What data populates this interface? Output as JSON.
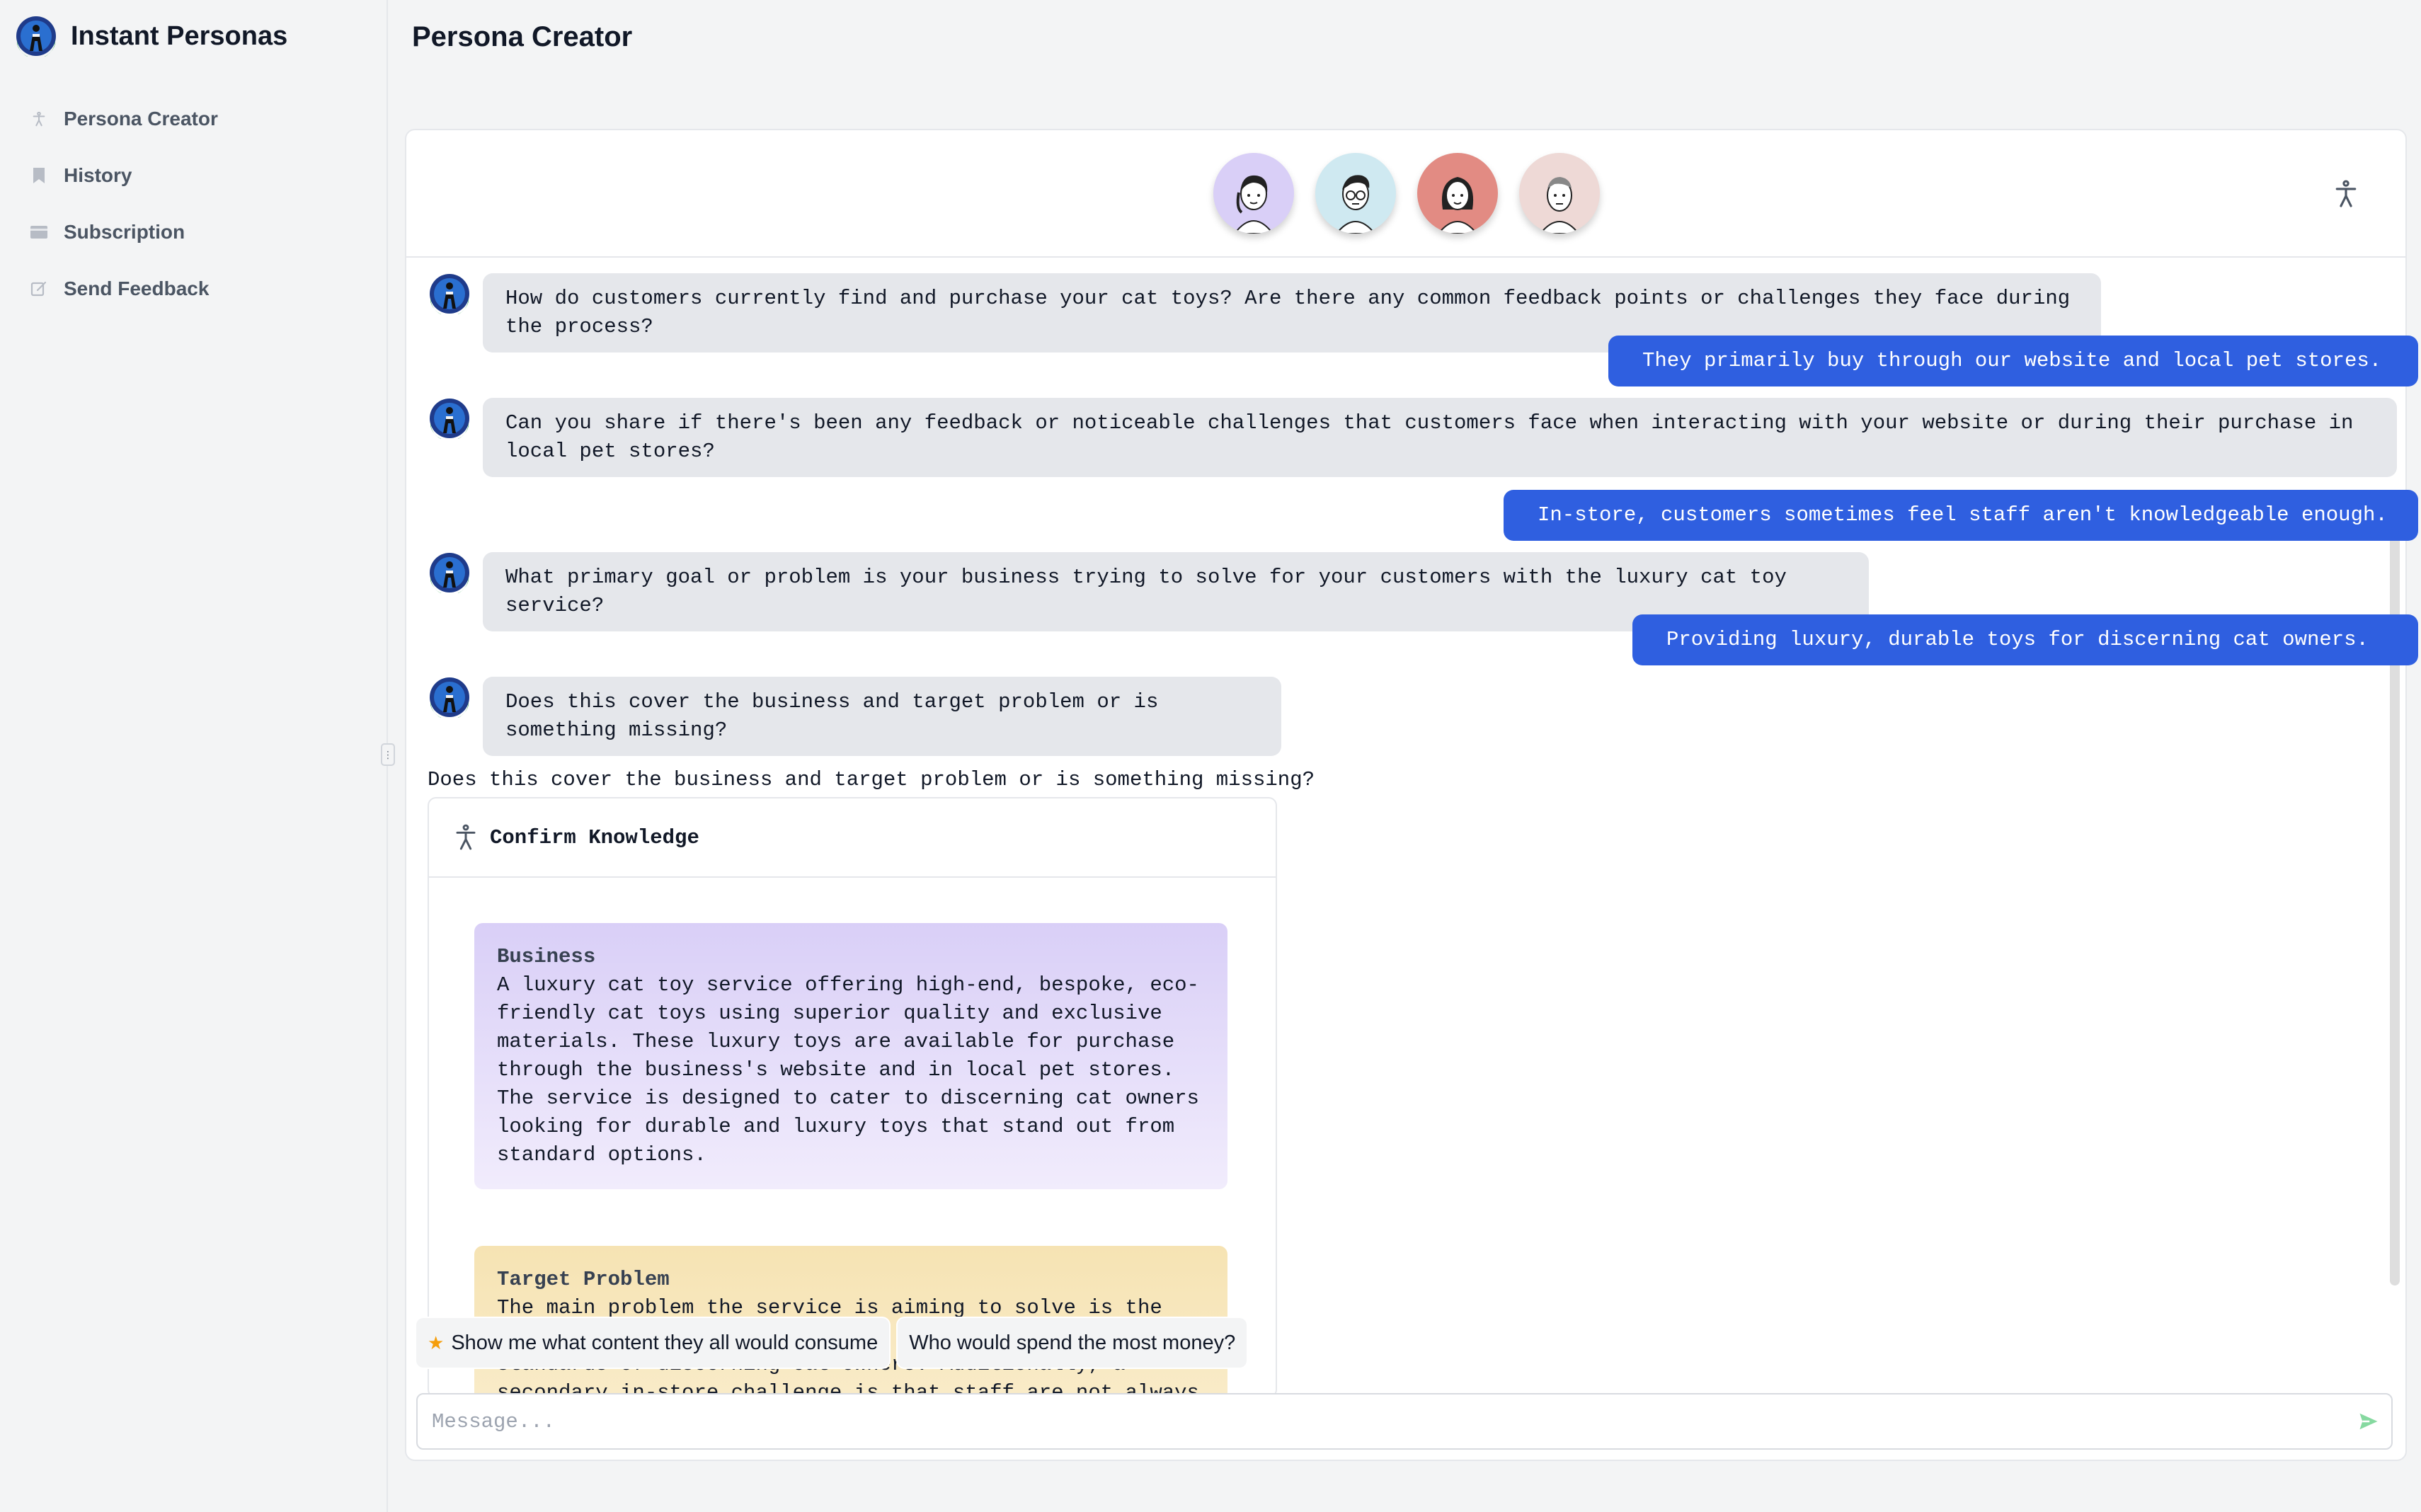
{
  "app": {
    "name": "Instant Personas"
  },
  "sidebar": {
    "items": [
      {
        "label": "Persona Creator",
        "icon": "person-icon"
      },
      {
        "label": "History",
        "icon": "bookmark-icon"
      },
      {
        "label": "Subscription",
        "icon": "card-icon"
      },
      {
        "label": "Send Feedback",
        "icon": "edit-icon"
      }
    ]
  },
  "header": {
    "title": "Persona Creator"
  },
  "personas": [
    {
      "name": "persona-1",
      "bg": "#d9cff7"
    },
    {
      "name": "persona-2",
      "bg": "#cfe9f1"
    },
    {
      "name": "persona-3",
      "bg": "#e28b83"
    },
    {
      "name": "persona-4",
      "bg": "#eed9d6"
    }
  ],
  "chat": {
    "messages": [
      {
        "role": "bot",
        "text": "How do customers currently find and purchase your cat toys? Are there any common feedback points or challenges they face during the process?"
      },
      {
        "role": "user",
        "text": "They primarily buy through our website and local pet stores."
      },
      {
        "role": "bot",
        "text": "Can you share if there's been any feedback or noticeable challenges that customers face when interacting with your website or during their purchase in local pet stores?"
      },
      {
        "role": "user",
        "text": "In-store, customers sometimes feel staff aren't knowledgeable enough."
      },
      {
        "role": "bot",
        "text": "What primary goal or problem is your business trying to solve for your customers with the luxury cat toy service?"
      },
      {
        "role": "user",
        "text": "Providing luxury, durable toys for discerning cat owners."
      },
      {
        "role": "bot",
        "text": "Does this cover the business and target problem or is something missing?"
      }
    ],
    "plain_question": "Does this cover the business and target problem or is something missing?"
  },
  "confirm_card": {
    "title": "Confirm Knowledge",
    "business": {
      "title": "Business",
      "text": "A luxury cat toy service offering high-end, bespoke, eco-friendly cat toys using superior quality and exclusive materials. These luxury toys are available for purchase through the business's website and in local pet stores. The service is designed to cater to discerning cat owners looking for durable and luxury toys that stand out from standard options."
    },
    "target_problem": {
      "title": "Target Problem",
      "text": "The main problem the service is aiming to solve is the lack of luxury, durable cat toys that meet the high standards of discerning cat owners. Additionally, a secondary in-store challenge is that staff are not always knowledgeable enough."
    }
  },
  "suggestions": [
    {
      "label": "Show me what content they all would consume",
      "icon": "star-icon"
    },
    {
      "label": "Who would spend the most money?"
    }
  ],
  "composer": {
    "placeholder": "Message..."
  },
  "colors": {
    "accent": "#2f5fe0",
    "bot_bubble": "#e5e7eb",
    "send": "#86d9a0"
  }
}
